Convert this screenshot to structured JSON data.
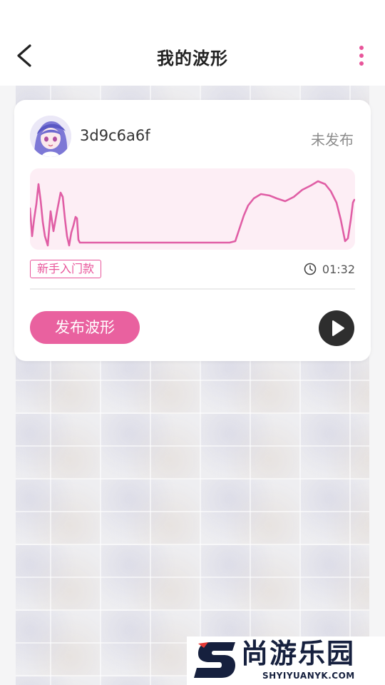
{
  "header": {
    "title": "我的波形",
    "back_icon": "chevron-left-icon",
    "more_icon": "vertical-dots-icon",
    "accent_color": "#e8559a"
  },
  "card": {
    "username": "3d9c6a6f",
    "status": "未发布",
    "tag": "新手入门款",
    "duration": "01:32",
    "publish_label": "发布波形",
    "play_icon": "play-icon",
    "clock_icon": "clock-icon",
    "wave_color": "#e05ea5",
    "wave_background": "#fdeef5"
  },
  "watermark": {
    "text": "尚游乐园",
    "sub": "SHYIYUANYK.COM"
  }
}
